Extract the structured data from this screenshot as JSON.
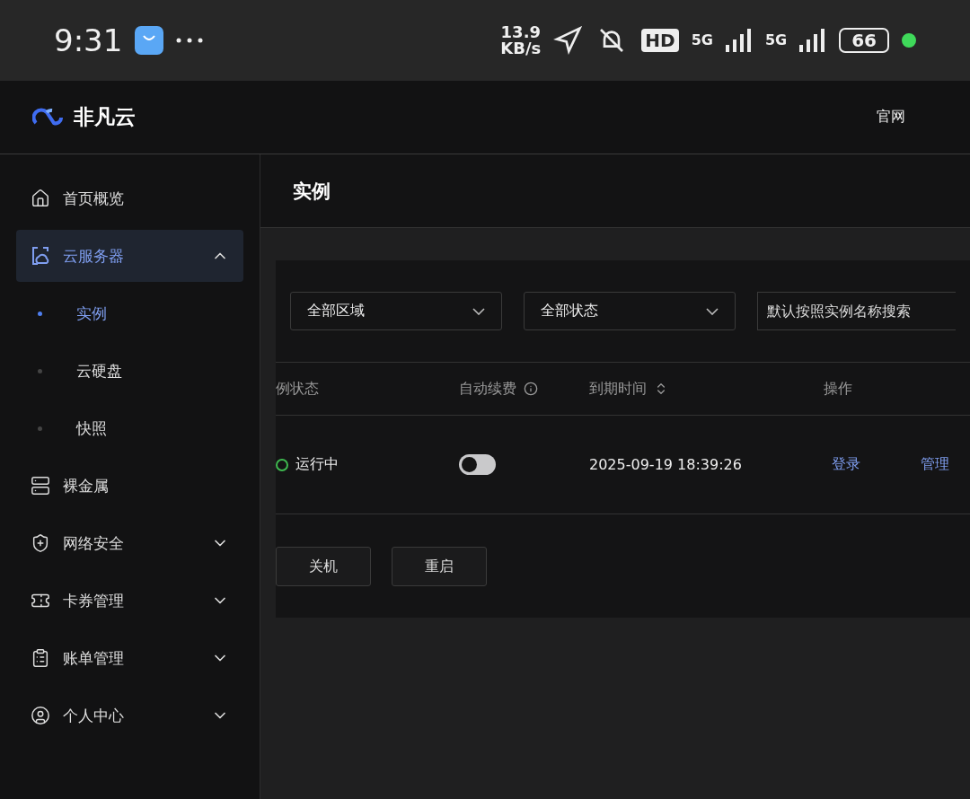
{
  "status_bar": {
    "time": "9:31",
    "speed": "13.9",
    "speed_unit": "KB/s",
    "hd": "HD",
    "signal_1": "5G",
    "signal_2": "5G",
    "battery": "66"
  },
  "header": {
    "brand": "非凡云",
    "links": [
      "官网"
    ]
  },
  "sidebar": {
    "items": [
      {
        "label": "首页概览",
        "kind": "home",
        "selected": false
      },
      {
        "label": "云服务器",
        "kind": "cloud",
        "selected": true,
        "expanded": true,
        "children": [
          {
            "label": "实例",
            "selected": true
          },
          {
            "label": "云硬盘",
            "selected": false
          },
          {
            "label": "快照",
            "selected": false
          }
        ]
      },
      {
        "label": "裸金属",
        "kind": "server",
        "selected": false
      },
      {
        "label": "网络安全",
        "kind": "shield",
        "selected": false,
        "expanded": false
      },
      {
        "label": "卡券管理",
        "kind": "ticket",
        "selected": false,
        "expanded": false
      },
      {
        "label": "账单管理",
        "kind": "clipboard",
        "selected": false,
        "expanded": false
      },
      {
        "label": "个人中心",
        "kind": "user",
        "selected": false,
        "expanded": false
      }
    ]
  },
  "page": {
    "title": "实例"
  },
  "filters": {
    "region": "全部区域",
    "status": "全部状态",
    "search_placeholder": "默认按照实例名称搜索"
  },
  "table": {
    "columns": [
      "例状态",
      "自动续费",
      "到期时间",
      "操作"
    ],
    "rows": [
      {
        "status": "运行中",
        "auto_renew": false,
        "expiry": "2025-09-19 18:39:26",
        "actions": [
          "登录",
          "管理"
        ]
      }
    ]
  },
  "buttons": [
    "关机",
    "重启"
  ]
}
